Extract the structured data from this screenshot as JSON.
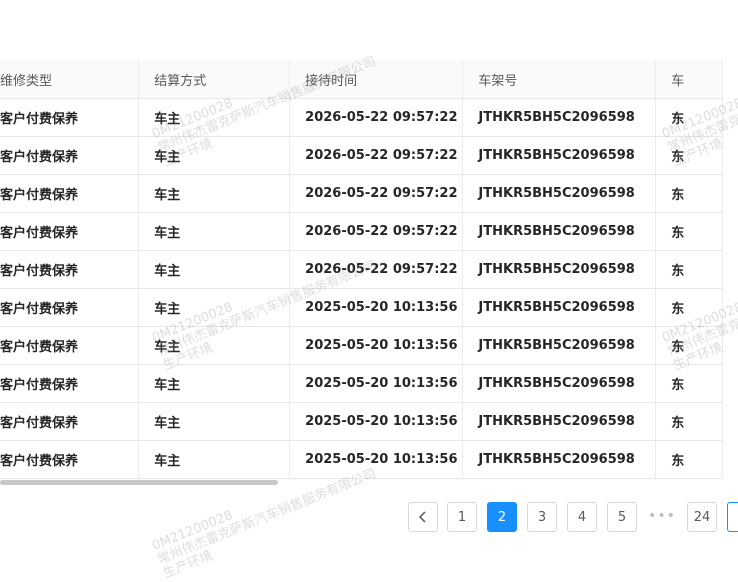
{
  "table": {
    "headers": [
      "维修类型",
      "结算方式",
      "接待时间",
      "车架号",
      "车"
    ],
    "rows": [
      [
        "客户付费保养",
        "车主",
        "2026-05-22 09:57:22",
        "JTHKR5BH5C2096598",
        "东"
      ],
      [
        "客户付费保养",
        "车主",
        "2026-05-22 09:57:22",
        "JTHKR5BH5C2096598",
        "东"
      ],
      [
        "客户付费保养",
        "车主",
        "2026-05-22 09:57:22",
        "JTHKR5BH5C2096598",
        "东"
      ],
      [
        "客户付费保养",
        "车主",
        "2026-05-22 09:57:22",
        "JTHKR5BH5C2096598",
        "东"
      ],
      [
        "客户付费保养",
        "车主",
        "2026-05-22 09:57:22",
        "JTHKR5BH5C2096598",
        "东"
      ],
      [
        "客户付费保养",
        "车主",
        "2025-05-20 10:13:56",
        "JTHKR5BH5C2096598",
        "东"
      ],
      [
        "客户付费保养",
        "车主",
        "2025-05-20 10:13:56",
        "JTHKR5BH5C2096598",
        "东"
      ],
      [
        "客户付费保养",
        "车主",
        "2025-05-20 10:13:56",
        "JTHKR5BH5C2096598",
        "东"
      ],
      [
        "客户付费保养",
        "车主",
        "2025-05-20 10:13:56",
        "JTHKR5BH5C2096598",
        "东"
      ],
      [
        "客户付费保养",
        "车主",
        "2025-05-20 10:13:56",
        "JTHKR5BH5C2096598",
        "东"
      ]
    ]
  },
  "scrollbar": {
    "horizontal_position": 0.0
  },
  "pagination": {
    "prev_icon": "chevron-left-icon",
    "pages": [
      "1",
      "2",
      "3",
      "4",
      "5"
    ],
    "current": "2",
    "ellipsis": "•••",
    "last": "24"
  },
  "watermark": {
    "code": "0M21200028",
    "company": "常州伟杰雷克萨斯汽车销售服务有限公司",
    "env": "生产环境"
  },
  "colors": {
    "accent": "#1890ff",
    "header_bg": "#fafafa",
    "border": "#e8e8e8"
  }
}
